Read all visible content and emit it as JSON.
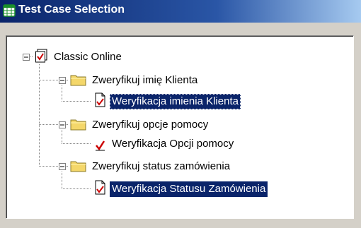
{
  "window": {
    "title": "Test Case Selection",
    "title_icon": "calendar-grid-icon"
  },
  "tree": {
    "root": {
      "label": "Classic Online",
      "icon": "checklist-icon",
      "expanded": true
    },
    "groups": [
      {
        "label": "Zweryfikuj imię Klienta",
        "icon": "folder-icon",
        "expanded": true,
        "child": {
          "label": "Weryfikacja imienia Klienta",
          "icon": "document-check-icon",
          "selected": true
        }
      },
      {
        "label": "Zweryfikuj opcje pomocy",
        "icon": "folder-icon",
        "expanded": true,
        "child": {
          "label": "Weryfikacja Opcji pomocy",
          "icon": "checkmark-icon",
          "selected": false
        }
      },
      {
        "label": "Zweryfikuj status zamówienia",
        "icon": "folder-icon",
        "expanded": true,
        "child": {
          "label": "Weryfikacja Statusu Zamówienia",
          "icon": "document-check-icon",
          "selected": true
        }
      }
    ]
  },
  "colors": {
    "selection": "#0a246a",
    "title_start": "#0a246a",
    "title_end": "#a6caf0",
    "folder": "#f4d76a",
    "check": "#cc0000"
  }
}
